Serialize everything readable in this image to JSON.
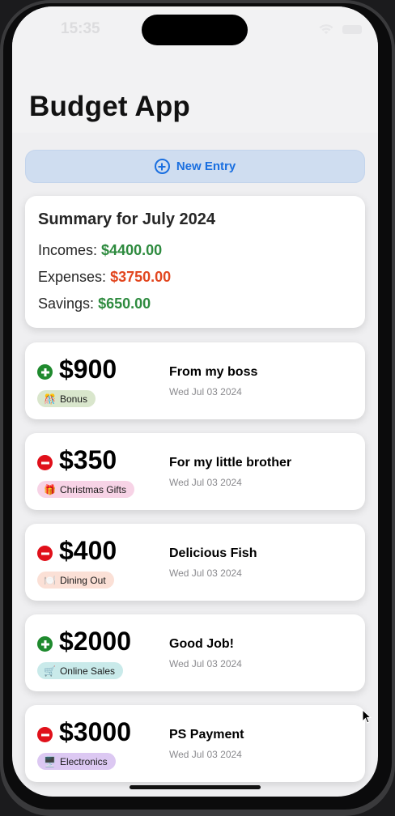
{
  "status": {
    "time": "15:35"
  },
  "app": {
    "title": "Budget App"
  },
  "new_entry": {
    "label": "New Entry"
  },
  "summary": {
    "title": "Summary for July 2024",
    "incomes_label": "Incomes:",
    "incomes_value": "$4400.00",
    "expenses_label": "Expenses:",
    "expenses_value": "$3750.00",
    "savings_label": "Savings:",
    "savings_value": "$650.00"
  },
  "colors": {
    "income": "#2e8b3f",
    "expense": "#e2461f",
    "accent": "#1a6fe0"
  },
  "entries": [
    {
      "type": "income",
      "amount": "$900",
      "category": "Bonus",
      "category_icon": "🎊",
      "badge_color": "#d9e6cc",
      "title": "From my boss",
      "date": "Wed Jul 03 2024"
    },
    {
      "type": "expense",
      "amount": "$350",
      "category": "Christmas Gifts",
      "category_icon": "🎁",
      "badge_color": "#f7d3e6",
      "title": "For my little brother",
      "date": "Wed Jul 03 2024"
    },
    {
      "type": "expense",
      "amount": "$400",
      "category": "Dining Out",
      "category_icon": "🍽️",
      "badge_color": "#fbe0d6",
      "title": "Delicious Fish",
      "date": "Wed Jul 03 2024"
    },
    {
      "type": "income",
      "amount": "$2000",
      "category": "Online Sales",
      "category_icon": "🛒",
      "badge_color": "#c9eaea",
      "title": "Good Job!",
      "date": "Wed Jul 03 2024"
    },
    {
      "type": "expense",
      "amount": "$3000",
      "category": "Electronics",
      "category_icon": "🖥️",
      "badge_color": "#dcc8f2",
      "title": "PS Payment",
      "date": "Wed Jul 03 2024"
    }
  ]
}
